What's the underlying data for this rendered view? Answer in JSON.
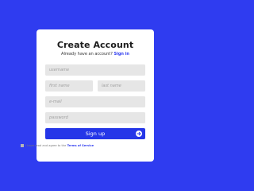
{
  "form": {
    "title": "Create Account",
    "prompt_text": "Already have an account?",
    "signin_link": "Sign in",
    "username_placeholder": "username",
    "first_name_placeholder": "first name",
    "last_name_placeholder": "last name",
    "email_placeholder": "e-mail",
    "password_placeholder": "password",
    "signup_label": "Sign up",
    "arrow_icon": "arrow-right-icon",
    "terms_text": "I have read and agree to the",
    "terms_link": "Terms of Service"
  },
  "colors": {
    "background": "#2f3cf0",
    "accent": "#2536e8",
    "card": "#ffffff",
    "field": "#e6e6e6"
  }
}
